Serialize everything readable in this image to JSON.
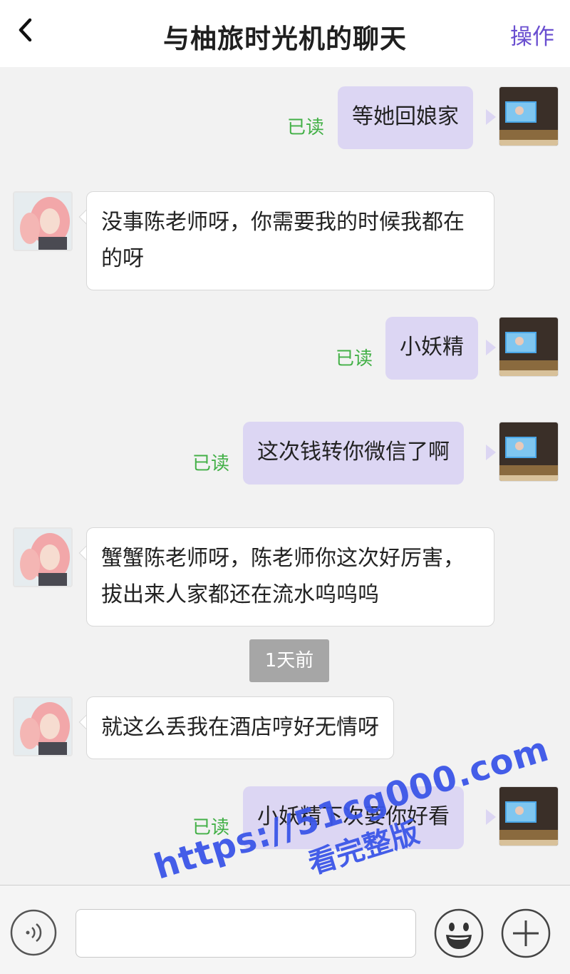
{
  "header": {
    "title": "与柚旅时光机的聊天",
    "action_label": "操作"
  },
  "messages": [
    {
      "direction": "out",
      "text": "等她回娘家",
      "status": "已读"
    },
    {
      "direction": "in",
      "text": "没事陈老师呀，你需要我的时候我都在的呀"
    },
    {
      "direction": "out",
      "text": "小妖精",
      "status": "已读"
    },
    {
      "direction": "out",
      "text": "这次钱转你微信了啊",
      "status": "已读"
    },
    {
      "direction": "in",
      "text": "蟹蟹陈老师呀，陈老师你这次好厉害，拔出来人家都还在流水呜呜呜"
    },
    {
      "direction": "in",
      "text": "就这么丢我在酒店哼好无情呀"
    },
    {
      "direction": "out",
      "text": "小妖精下次要你好看",
      "status": "已读"
    }
  ],
  "time_divider": "1天前",
  "input": {
    "value": "",
    "placeholder": ""
  },
  "icons": {
    "back": "chevron-left-icon",
    "voice": "voice-icon",
    "emoji": "emoji-icon",
    "plus": "plus-icon"
  },
  "colors": {
    "outgoing_bubble": "#dcd6f3",
    "incoming_bubble": "#ffffff",
    "read_status": "#43b047",
    "action": "#6a4fd0",
    "watermark": "#3b56e8"
  },
  "watermark": {
    "line1": "https://51cg000.com",
    "line2": "看完整版"
  }
}
